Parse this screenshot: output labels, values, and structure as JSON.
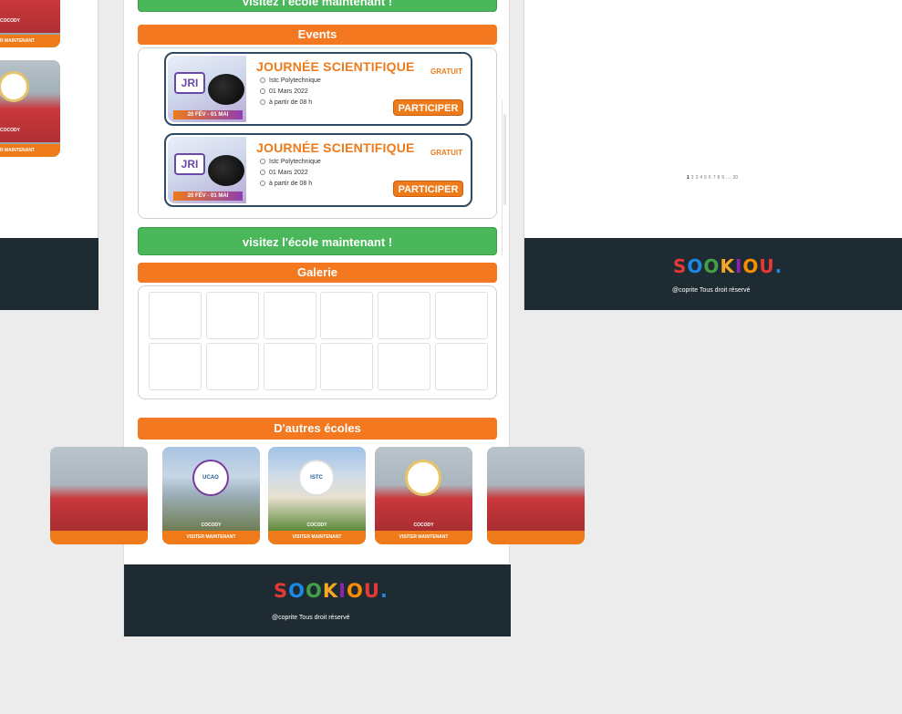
{
  "left_panel": {
    "cards": [
      {
        "city": "COCODY",
        "cta": "R MAINTENANT"
      },
      {
        "city": "COCODY",
        "cta": "R MAINTENANT"
      }
    ]
  },
  "center": {
    "top_button": "visitez l'école maintenant !",
    "events_title": "Events",
    "events": [
      {
        "title": "JOURNÉE SCIENTIFIQUE",
        "free": "GRATUIT",
        "place": "Istc Polytechnique",
        "date": "01 Mars 2022",
        "time": "à partir de 08 h",
        "cta": "PARTICIPER",
        "badge": "JRI",
        "dates": "20 FÉV - 01 MAI"
      },
      {
        "title": "JOURNÉE SCIENTIFIQUE",
        "free": "GRATUIT",
        "place": "Istc Polytechnique",
        "date": "01 Mars 2022",
        "time": "à partir de 08 h",
        "cta": "PARTICIPER",
        "badge": "JRI",
        "dates": "20 FÉV - 01 MAI"
      }
    ],
    "visit_button": "visitez l'école maintenant !",
    "gallery_title": "Galerie",
    "others_title": "D'autres écoles",
    "schools": [
      {
        "badge": "",
        "city": "",
        "cta": ""
      },
      {
        "badge": "UCAO",
        "city": "COCODY",
        "cta": "VISITER MAINTENANT"
      },
      {
        "badge": "ISTC",
        "city": "COCODY",
        "cta": "VISITER MAINTENANT"
      },
      {
        "badge": "",
        "city": "COCODY",
        "cta": "VISITER MAINTENANT"
      },
      {
        "badge": "",
        "city": "",
        "cta": ""
      }
    ]
  },
  "right_panel": {
    "pagination": [
      "1",
      "2",
      "3",
      "4",
      "5",
      "6",
      "7",
      "8",
      "9",
      "....",
      "20"
    ],
    "current_page": "1"
  },
  "footer": {
    "logo_letters": [
      "S",
      "O",
      "O",
      "K",
      "I",
      "O",
      "U",
      "."
    ],
    "logo_colors": [
      "#e53935",
      "#1e88e5",
      "#43a047",
      "#f9a825",
      "#8e24aa",
      "#fb8c00",
      "#e53935",
      "#1e88e5"
    ],
    "copyright": "@coprite Tous droit réservé"
  }
}
